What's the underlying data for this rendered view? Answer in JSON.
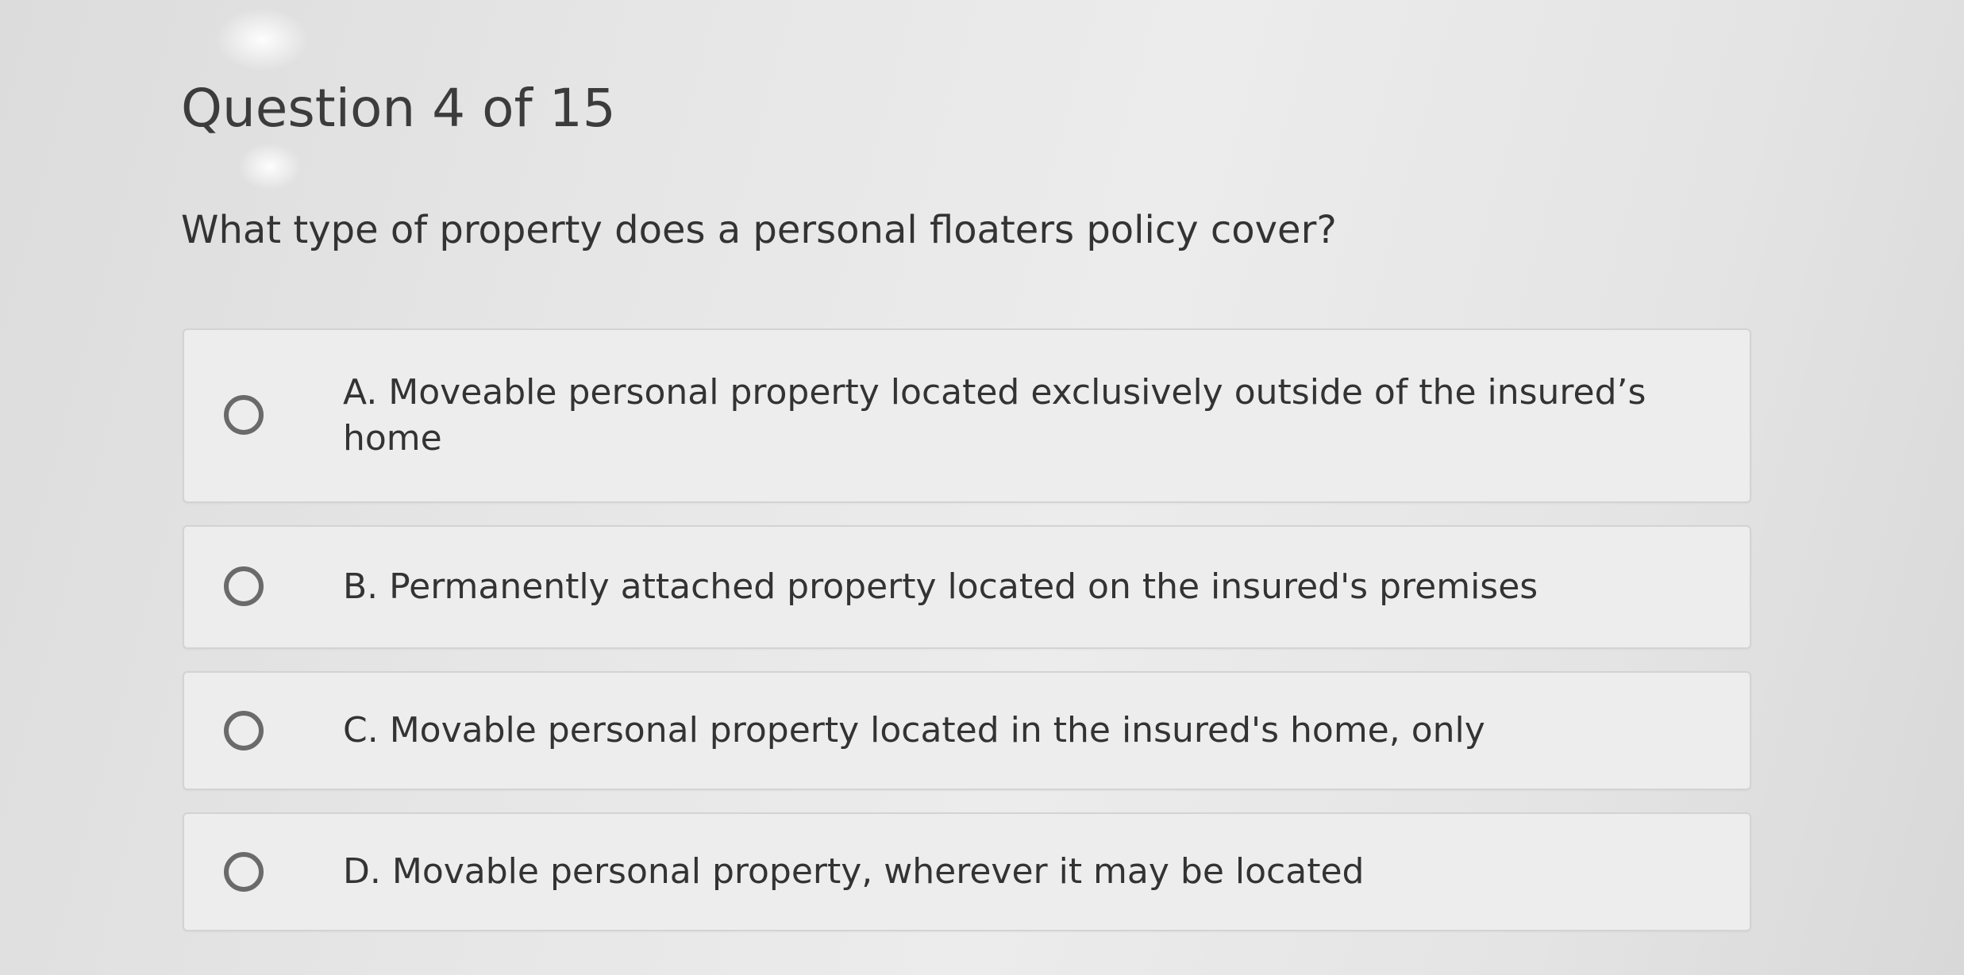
{
  "header": {
    "title": "Question 4 of 15"
  },
  "question": {
    "text": "What type of property does a personal floaters policy cover?"
  },
  "options": [
    {
      "label": "A. Moveable personal property located exclusively outside of the insured’s home"
    },
    {
      "label": "B. Permanently attached property located on the insured's premises"
    },
    {
      "label": "C. Movable personal property located in the insured's home, only"
    },
    {
      "label": "D. Movable personal property, wherever it may be located"
    }
  ],
  "colors": {
    "background": "#e6e6e6",
    "option_background": "#ededed",
    "option_border": "#d3d3d3",
    "radio_border": "#6a6a6a",
    "text": "#333333"
  },
  "icons": {
    "radio": "radio-button-unselected-icon"
  }
}
